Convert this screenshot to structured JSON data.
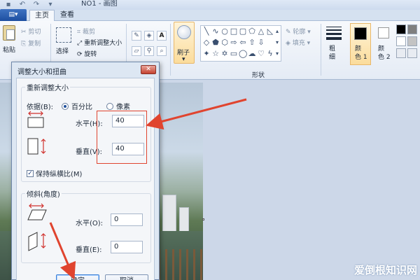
{
  "window": {
    "title": "NO1 - 画图",
    "quick_access": [
      "save-icon",
      "undo-icon",
      "redo-icon",
      "dropdown-icon"
    ]
  },
  "tabs": [
    {
      "label": "主页",
      "active": true
    },
    {
      "label": "查看",
      "active": false
    }
  ],
  "ribbon": {
    "clipboard": {
      "paste": "粘贴",
      "cut": "剪切",
      "copy": "复制"
    },
    "image": {
      "select": "选择",
      "crop": "裁剪",
      "resize": "重新调整大小",
      "rotate": "旋转"
    },
    "brushes": {
      "label": "刷子"
    },
    "shapes": {
      "group_label": "形状",
      "outline": "轮廓",
      "fill": "填充"
    },
    "size": {
      "label": "粗\n细"
    },
    "colors": {
      "color1": "颜\n色 1",
      "color2": "颜\n色 2",
      "color1_value": "#000000",
      "color2_value": "#ffffff"
    }
  },
  "dialog": {
    "title": "调整大小和扭曲",
    "close": "✕",
    "resize_group": "重新调整大小",
    "by_label": "依据(B):",
    "percent": "百分比",
    "pixels": "像素",
    "percent_selected": true,
    "horizontal_label": "水平(H):",
    "horizontal_value": "40",
    "vertical_label": "垂直(V):",
    "vertical_value": "40",
    "keep_ratio": "保持纵横比(M)",
    "keep_ratio_checked": true,
    "skew_group": "倾斜(角度)",
    "skew_h_label": "水平(O):",
    "skew_h_value": "0",
    "skew_v_label": "垂直(E):",
    "skew_v_value": "0",
    "ok": "确定",
    "cancel": "取消"
  },
  "watermark": "爱倒根知识网",
  "colors": {
    "annotation_red": "#e0442f",
    "accent_blue": "#1f4f9c"
  }
}
